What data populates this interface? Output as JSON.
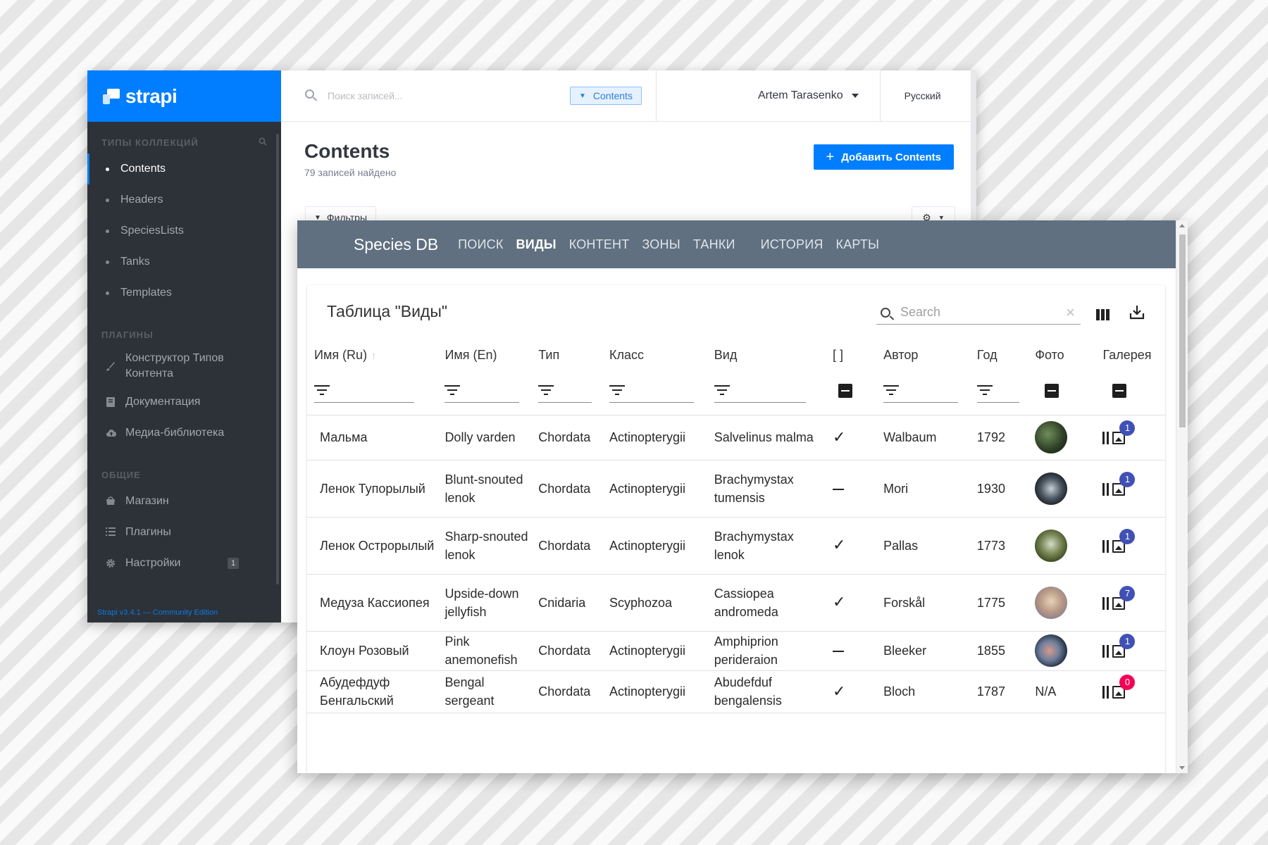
{
  "strapi": {
    "brand": "strapi",
    "sidebar": {
      "collections_title": "Типы коллекций",
      "collections": [
        {
          "label": "Contents",
          "active": true
        },
        {
          "label": "Headers"
        },
        {
          "label": "SpeciesLists"
        },
        {
          "label": "Tanks"
        },
        {
          "label": "Templates"
        }
      ],
      "plugins_title": "Плагины",
      "plugins": [
        {
          "label": "Конструктор Типов Контента",
          "icon": "brush-icon"
        },
        {
          "label": "Документация",
          "icon": "book-icon"
        },
        {
          "label": "Медиа-библиотека",
          "icon": "cloud-upload-icon"
        }
      ],
      "general_title": "Общие",
      "general": [
        {
          "label": "Магазин",
          "icon": "shop-icon"
        },
        {
          "label": "Плагины",
          "icon": "list-icon"
        },
        {
          "label": "Настройки",
          "icon": "gear-icon",
          "badge": "1"
        }
      ],
      "version": "Strapi v3.4.1 — Community Edition"
    },
    "topbar": {
      "search_placeholder": "Поиск записей...",
      "filter_tag": "Contents",
      "user": "Artem Tarasenko",
      "language": "Русский"
    },
    "header": {
      "title": "Contents",
      "count_text": "79 записей найдено",
      "add_button": "Добавить Contents",
      "filters_button": "Фильтры"
    },
    "colors": {
      "brand": "#007eff",
      "sidebar": "#2d3138"
    }
  },
  "species": {
    "app_title": "Species DB",
    "nav": [
      {
        "label": "ПОИСК"
      },
      {
        "label": "ВИДЫ",
        "active": true
      },
      {
        "label": "КОНТЕНТ"
      },
      {
        "label": "ЗОНЫ"
      },
      {
        "label": "ТАНКИ"
      },
      {
        "label": "ИСТОРИЯ"
      },
      {
        "label": "КАРТЫ"
      }
    ],
    "table_title": "Таблица \"Виды\"",
    "search_placeholder": "Search",
    "columns": [
      "Имя (Ru)",
      "Имя (En)",
      "Тип",
      "Класс",
      "Вид",
      "[ ]",
      "Автор",
      "Год",
      "Фото",
      "Галерея"
    ],
    "rows": [
      {
        "ru": "Мальма",
        "en": "Dolly varden",
        "type": "Chordata",
        "class": "Actinopterygii",
        "species": "Salvelinus malma",
        "flag": "check",
        "author": "Walbaum",
        "year": "1792",
        "photo": "fish-photo-1",
        "gallery": "1"
      },
      {
        "ru": "Ленок Тупорылый",
        "en": "Blunt-snouted lenok",
        "type": "Chordata",
        "class": "Actinopterygii",
        "species": "Brachymystax tumensis",
        "flag": "dash",
        "author": "Mori",
        "year": "1930",
        "photo": "fish-photo-2",
        "gallery": "1"
      },
      {
        "ru": "Ленок Острорылый",
        "en": "Sharp-snouted lenok",
        "type": "Chordata",
        "class": "Actinopterygii",
        "species": "Brachymystax lenok",
        "flag": "check",
        "author": "Pallas",
        "year": "1773",
        "photo": "fish-photo-3",
        "gallery": "1"
      },
      {
        "ru": "Медуза Кассиопея",
        "en": "Upside-down jellyfish",
        "type": "Cnidaria",
        "class": "Scyphozoa",
        "species": "Cassiopea andromeda",
        "flag": "check",
        "author": "Forskål",
        "year": "1775",
        "photo": "jellyfish-photo",
        "gallery": "7"
      },
      {
        "ru": "Клоун Розовый",
        "en": "Pink anemonefish",
        "type": "Chordata",
        "class": "Actinopterygii",
        "species": "Amphiprion perideraion",
        "flag": "dash",
        "author": "Bleeker",
        "year": "1855",
        "photo": "fish-photo-5",
        "gallery": "1"
      },
      {
        "ru": "Абудефдуф Бенгальский",
        "en": "Bengal sergeant",
        "type": "Chordata",
        "class": "Actinopterygii",
        "species": "Abudefduf bengalensis",
        "flag": "check",
        "author": "Bloch",
        "year": "1787",
        "photo": "N/A",
        "gallery": "0"
      }
    ],
    "colors": {
      "appbar": "#607080",
      "badge": "#3f51b5",
      "badge_zero": "#f50057"
    }
  }
}
